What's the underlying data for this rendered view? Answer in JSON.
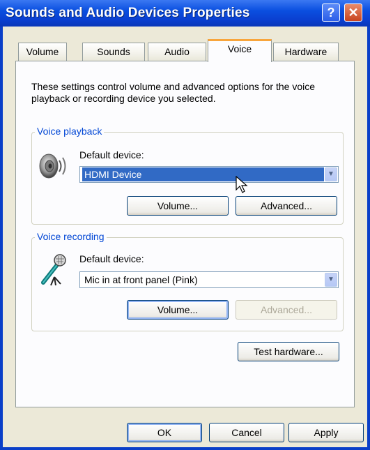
{
  "window": {
    "title": "Sounds and Audio Devices Properties",
    "help_glyph": "?",
    "close_glyph": "✕"
  },
  "tabs": [
    {
      "label": "Volume"
    },
    {
      "label": "Sounds"
    },
    {
      "label": "Audio"
    },
    {
      "label": "Voice"
    },
    {
      "label": "Hardware"
    }
  ],
  "active_tab": "Voice",
  "description": "These settings control volume and advanced options for the voice playback or recording device you selected.",
  "voice_playback": {
    "group_label": "Voice playback",
    "device_label": "Default device:",
    "device_value": "HDMI Device",
    "volume_button": "Volume...",
    "advanced_button": "Advanced..."
  },
  "voice_recording": {
    "group_label": "Voice recording",
    "device_label": "Default device:",
    "device_value": "Mic in at front panel (Pink)",
    "volume_button": "Volume...",
    "advanced_button": "Advanced..."
  },
  "test_hardware_button": "Test hardware...",
  "footer": {
    "ok": "OK",
    "cancel": "Cancel",
    "apply": "Apply"
  },
  "colors": {
    "title_blue": "#0a3fd0",
    "group_label": "#0046d5",
    "selection": "#316ac5",
    "tab_highlight": "#f8a53c"
  },
  "icons": {
    "speaker": "speaker-icon",
    "microphone": "microphone-icon",
    "dropdown": "chevron-down-icon"
  }
}
